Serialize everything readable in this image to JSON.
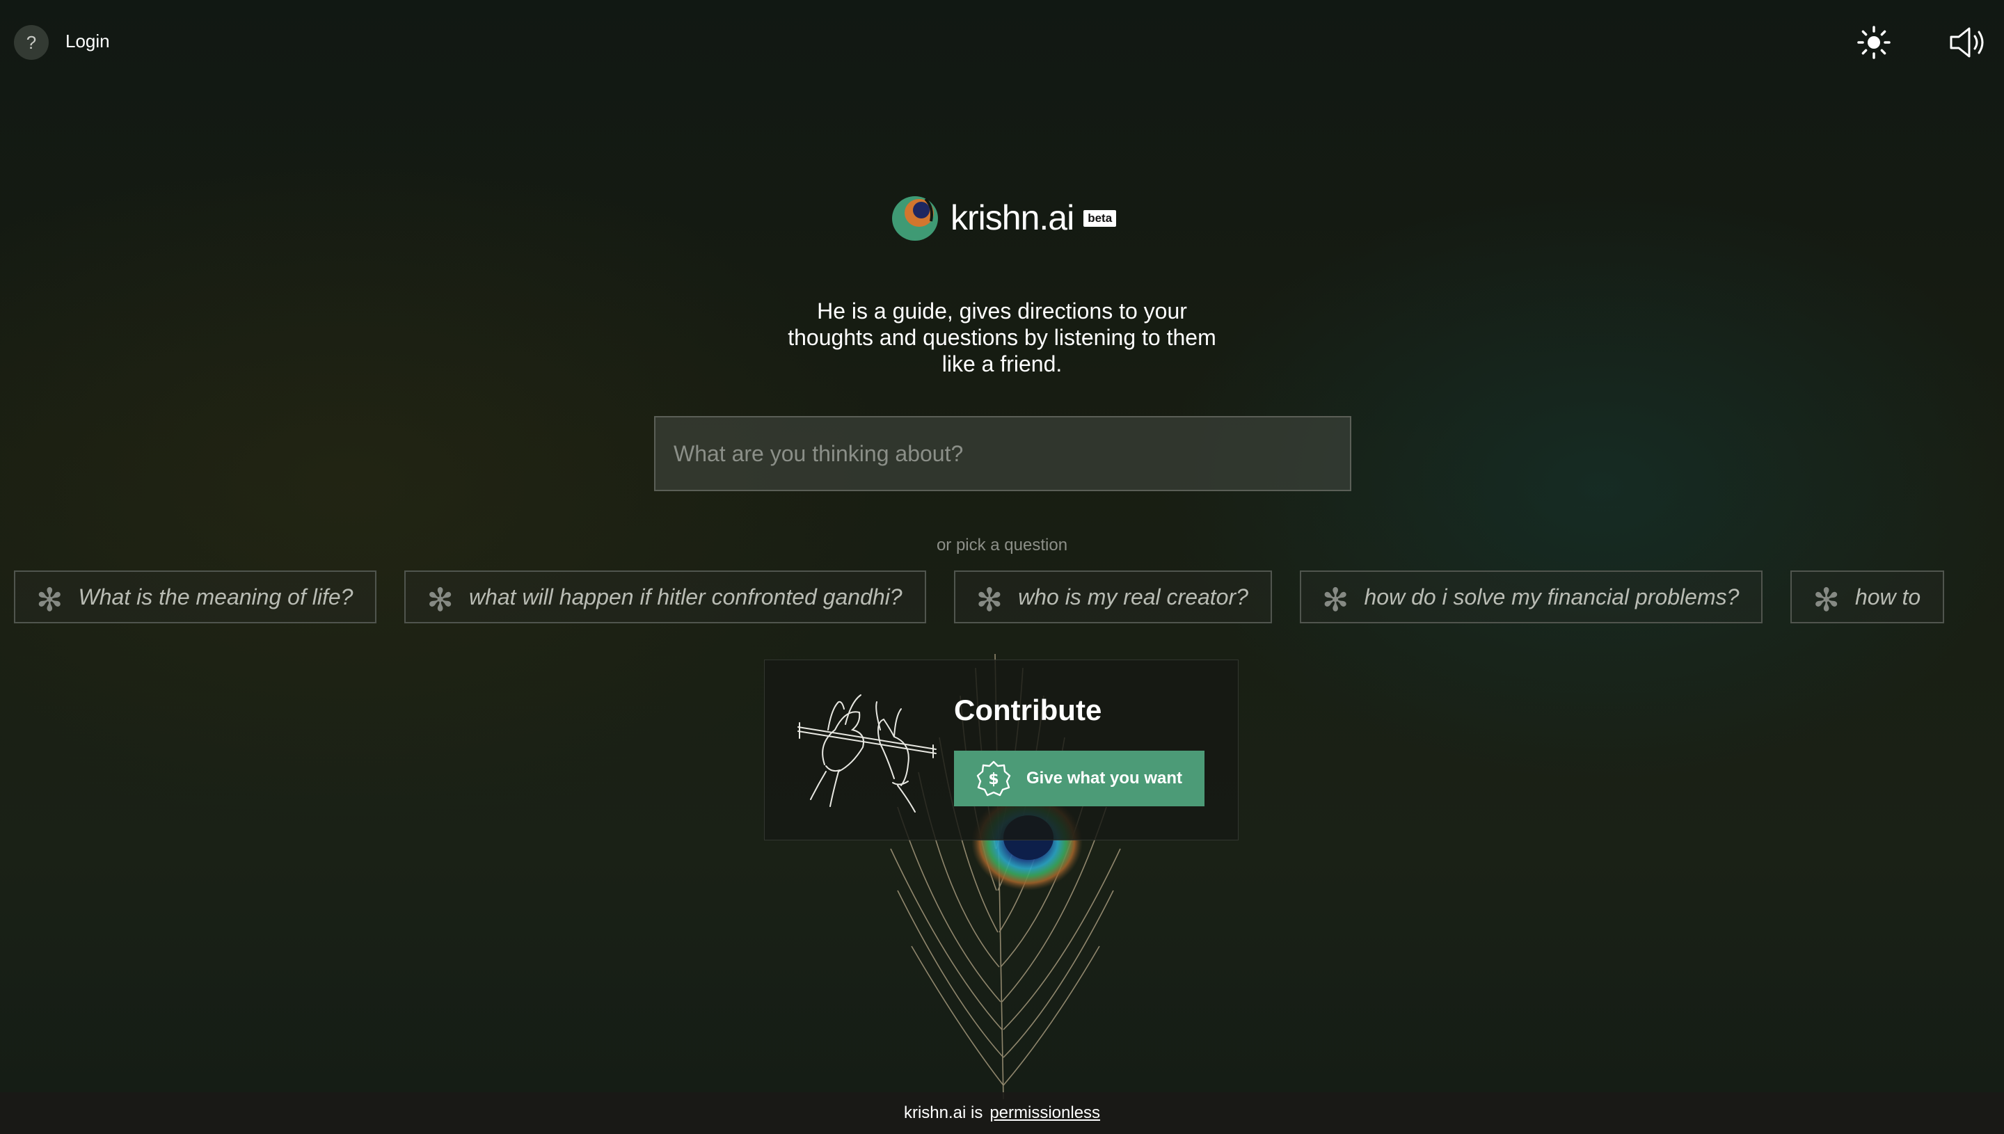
{
  "header": {
    "help_symbol": "?",
    "login_label": "Login",
    "theme_icon": "sun-icon",
    "sound_icon": "speaker-icon"
  },
  "brand": {
    "name": "krishn.ai",
    "badge": "beta",
    "logo_icon": "peacock-feather-logo"
  },
  "tagline": "He is a guide, gives directions to your thoughts and questions by listening to them like a friend.",
  "search": {
    "placeholder": "What are you thinking about?",
    "value": ""
  },
  "questions": {
    "label": "or pick a question",
    "items": [
      "What is the meaning of life?",
      "what will happen if hitler confronted gandhi?",
      "who is my real creator?",
      "how do i solve my financial problems?",
      "how to"
    ]
  },
  "contribute": {
    "title": "Contribute",
    "button_label": "Give what you want",
    "button_icon": "dollar-badge-icon",
    "art_icon": "flute-hands-illustration"
  },
  "footer": {
    "text": "krishn.ai is",
    "link": "permissionless"
  },
  "colors": {
    "accent": "#4c9b77",
    "logo_green": "#3f9a74",
    "logo_orange": "#d2762e",
    "logo_navy": "#1e2761"
  }
}
